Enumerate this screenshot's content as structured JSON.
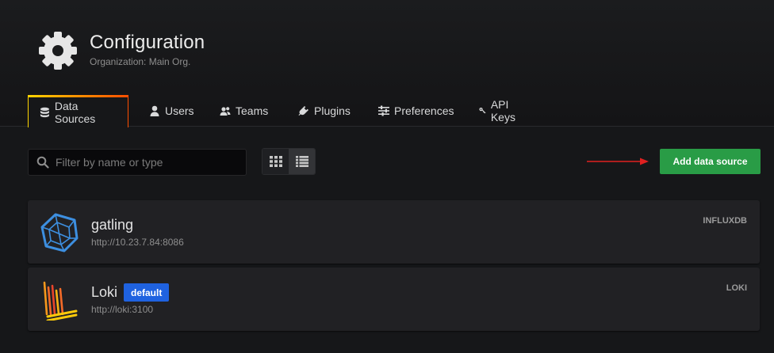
{
  "header": {
    "title": "Configuration",
    "subtitle": "Organization: Main Org."
  },
  "tabs": [
    {
      "label": "Data Sources",
      "icon": "database-icon",
      "active": true
    },
    {
      "label": "Users",
      "icon": "user-icon",
      "active": false
    },
    {
      "label": "Teams",
      "icon": "users-icon",
      "active": false
    },
    {
      "label": "Plugins",
      "icon": "plug-icon",
      "active": false
    },
    {
      "label": "Preferences",
      "icon": "sliders-icon",
      "active": false
    },
    {
      "label": "API Keys",
      "icon": "key-icon",
      "active": false
    }
  ],
  "toolbar": {
    "filter_placeholder": "Filter by name or type",
    "filter_value": "",
    "view_mode": "list",
    "add_label": "Add data source"
  },
  "datasources": [
    {
      "name": "gatling",
      "url": "http://10.23.7.84:8086",
      "type": "INFLUXDB",
      "is_default": false,
      "logo": "influxdb-logo"
    },
    {
      "name": "Loki",
      "url": "http://loki:3100",
      "type": "LOKI",
      "is_default": true,
      "badge": "default",
      "logo": "loki-logo"
    }
  ],
  "colors": {
    "background": "#161719",
    "accent_gradient": [
      "#ffd500",
      "#ff4d00"
    ],
    "primary_button": "#299c46",
    "default_badge": "#1f62e0",
    "annotation_arrow": "#e02020"
  }
}
